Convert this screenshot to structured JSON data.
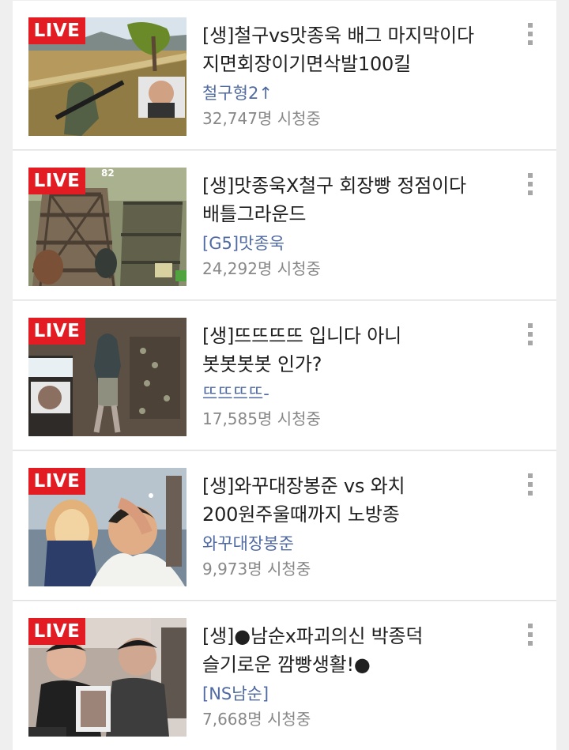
{
  "live_label": "LIVE",
  "items": [
    {
      "title": "[생]철구vs맛종욱 배그 마지막이다\n지면회장이기면삭발100킬",
      "channel": "철구형2↑",
      "viewers": "32,747명 시청중"
    },
    {
      "title": "[생]맛종욱X철구 회장빵 정점이다\n배틀그라운드",
      "channel": "[G5]맛종욱",
      "viewers": "24,292명 시청중"
    },
    {
      "title": "[생]뜨뜨뜨뜨 입니다 아니\n봇봇봇봇 인가?",
      "channel": "뜨뜨뜨뜨-",
      "viewers": "17,585명 시청중"
    },
    {
      "title": "[생]와꾸대장봉준 vs 와치\n200원주울때까지 노방종",
      "channel": "와꾸대장봉준",
      "viewers": "9,973명 시청중"
    },
    {
      "title": "[생]●남순x파괴의신 박종덕\n슬기로운 깜빵생활!●",
      "channel": "[NS남순]",
      "viewers": "7,668명 시청중"
    }
  ],
  "thumbnail_overlay": {
    "item2_number": "82"
  },
  "colors": {
    "live_badge": "#e31b23",
    "channel_text": "#506aa2",
    "viewers_text": "#888888",
    "title_text": "#202020",
    "background": "#efefef"
  },
  "icons": {
    "more_menu": "vertical-dots-icon"
  }
}
